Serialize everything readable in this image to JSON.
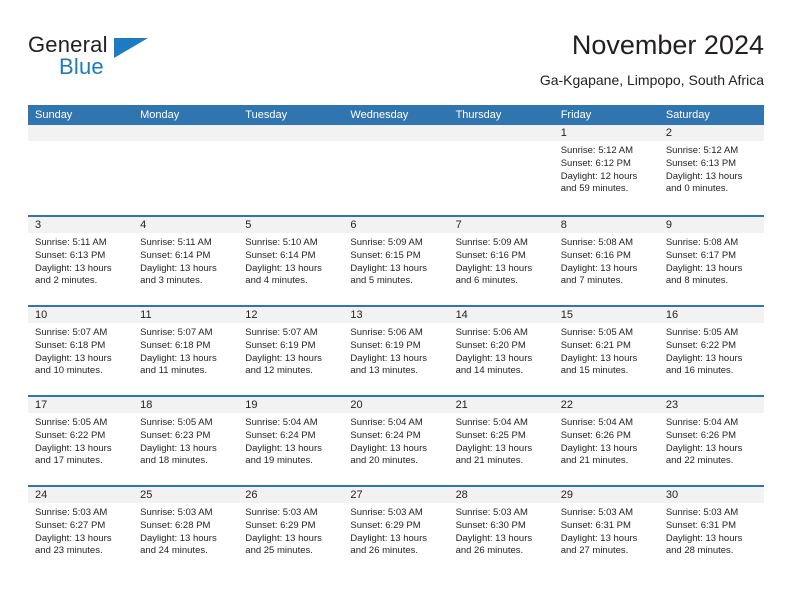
{
  "logo": {
    "word_top": "General",
    "word_bottom": "Blue",
    "triangle_icon": "triangle-icon",
    "accent_color": "#1f7bc1"
  },
  "header": {
    "title": "November 2024",
    "subtitle": "Ga-Kgapane, Limpopo, South Africa"
  },
  "calendar": {
    "header_color": "#3175b0",
    "band_color": "#f2f2f2",
    "weekdays": [
      "Sunday",
      "Monday",
      "Tuesday",
      "Wednesday",
      "Thursday",
      "Friday",
      "Saturday"
    ],
    "weeks": [
      [
        {
          "day": "",
          "sunrise": "",
          "sunset": "",
          "daylight": "",
          "empty": true
        },
        {
          "day": "",
          "sunrise": "",
          "sunset": "",
          "daylight": "",
          "empty": true
        },
        {
          "day": "",
          "sunrise": "",
          "sunset": "",
          "daylight": "",
          "empty": true
        },
        {
          "day": "",
          "sunrise": "",
          "sunset": "",
          "daylight": "",
          "empty": true
        },
        {
          "day": "",
          "sunrise": "",
          "sunset": "",
          "daylight": "",
          "empty": true
        },
        {
          "day": "1",
          "sunrise": "Sunrise: 5:12 AM",
          "sunset": "Sunset: 6:12 PM",
          "daylight": "Daylight: 12 hours and 59 minutes.",
          "empty": false
        },
        {
          "day": "2",
          "sunrise": "Sunrise: 5:12 AM",
          "sunset": "Sunset: 6:13 PM",
          "daylight": "Daylight: 13 hours and 0 minutes.",
          "empty": false
        }
      ],
      [
        {
          "day": "3",
          "sunrise": "Sunrise: 5:11 AM",
          "sunset": "Sunset: 6:13 PM",
          "daylight": "Daylight: 13 hours and 2 minutes.",
          "empty": false
        },
        {
          "day": "4",
          "sunrise": "Sunrise: 5:11 AM",
          "sunset": "Sunset: 6:14 PM",
          "daylight": "Daylight: 13 hours and 3 minutes.",
          "empty": false
        },
        {
          "day": "5",
          "sunrise": "Sunrise: 5:10 AM",
          "sunset": "Sunset: 6:14 PM",
          "daylight": "Daylight: 13 hours and 4 minutes.",
          "empty": false
        },
        {
          "day": "6",
          "sunrise": "Sunrise: 5:09 AM",
          "sunset": "Sunset: 6:15 PM",
          "daylight": "Daylight: 13 hours and 5 minutes.",
          "empty": false
        },
        {
          "day": "7",
          "sunrise": "Sunrise: 5:09 AM",
          "sunset": "Sunset: 6:16 PM",
          "daylight": "Daylight: 13 hours and 6 minutes.",
          "empty": false
        },
        {
          "day": "8",
          "sunrise": "Sunrise: 5:08 AM",
          "sunset": "Sunset: 6:16 PM",
          "daylight": "Daylight: 13 hours and 7 minutes.",
          "empty": false
        },
        {
          "day": "9",
          "sunrise": "Sunrise: 5:08 AM",
          "sunset": "Sunset: 6:17 PM",
          "daylight": "Daylight: 13 hours and 8 minutes.",
          "empty": false
        }
      ],
      [
        {
          "day": "10",
          "sunrise": "Sunrise: 5:07 AM",
          "sunset": "Sunset: 6:18 PM",
          "daylight": "Daylight: 13 hours and 10 minutes.",
          "empty": false
        },
        {
          "day": "11",
          "sunrise": "Sunrise: 5:07 AM",
          "sunset": "Sunset: 6:18 PM",
          "daylight": "Daylight: 13 hours and 11 minutes.",
          "empty": false
        },
        {
          "day": "12",
          "sunrise": "Sunrise: 5:07 AM",
          "sunset": "Sunset: 6:19 PM",
          "daylight": "Daylight: 13 hours and 12 minutes.",
          "empty": false
        },
        {
          "day": "13",
          "sunrise": "Sunrise: 5:06 AM",
          "sunset": "Sunset: 6:19 PM",
          "daylight": "Daylight: 13 hours and 13 minutes.",
          "empty": false
        },
        {
          "day": "14",
          "sunrise": "Sunrise: 5:06 AM",
          "sunset": "Sunset: 6:20 PM",
          "daylight": "Daylight: 13 hours and 14 minutes.",
          "empty": false
        },
        {
          "day": "15",
          "sunrise": "Sunrise: 5:05 AM",
          "sunset": "Sunset: 6:21 PM",
          "daylight": "Daylight: 13 hours and 15 minutes.",
          "empty": false
        },
        {
          "day": "16",
          "sunrise": "Sunrise: 5:05 AM",
          "sunset": "Sunset: 6:22 PM",
          "daylight": "Daylight: 13 hours and 16 minutes.",
          "empty": false
        }
      ],
      [
        {
          "day": "17",
          "sunrise": "Sunrise: 5:05 AM",
          "sunset": "Sunset: 6:22 PM",
          "daylight": "Daylight: 13 hours and 17 minutes.",
          "empty": false
        },
        {
          "day": "18",
          "sunrise": "Sunrise: 5:05 AM",
          "sunset": "Sunset: 6:23 PM",
          "daylight": "Daylight: 13 hours and 18 minutes.",
          "empty": false
        },
        {
          "day": "19",
          "sunrise": "Sunrise: 5:04 AM",
          "sunset": "Sunset: 6:24 PM",
          "daylight": "Daylight: 13 hours and 19 minutes.",
          "empty": false
        },
        {
          "day": "20",
          "sunrise": "Sunrise: 5:04 AM",
          "sunset": "Sunset: 6:24 PM",
          "daylight": "Daylight: 13 hours and 20 minutes.",
          "empty": false
        },
        {
          "day": "21",
          "sunrise": "Sunrise: 5:04 AM",
          "sunset": "Sunset: 6:25 PM",
          "daylight": "Daylight: 13 hours and 21 minutes.",
          "empty": false
        },
        {
          "day": "22",
          "sunrise": "Sunrise: 5:04 AM",
          "sunset": "Sunset: 6:26 PM",
          "daylight": "Daylight: 13 hours and 21 minutes.",
          "empty": false
        },
        {
          "day": "23",
          "sunrise": "Sunrise: 5:04 AM",
          "sunset": "Sunset: 6:26 PM",
          "daylight": "Daylight: 13 hours and 22 minutes.",
          "empty": false
        }
      ],
      [
        {
          "day": "24",
          "sunrise": "Sunrise: 5:03 AM",
          "sunset": "Sunset: 6:27 PM",
          "daylight": "Daylight: 13 hours and 23 minutes.",
          "empty": false
        },
        {
          "day": "25",
          "sunrise": "Sunrise: 5:03 AM",
          "sunset": "Sunset: 6:28 PM",
          "daylight": "Daylight: 13 hours and 24 minutes.",
          "empty": false
        },
        {
          "day": "26",
          "sunrise": "Sunrise: 5:03 AM",
          "sunset": "Sunset: 6:29 PM",
          "daylight": "Daylight: 13 hours and 25 minutes.",
          "empty": false
        },
        {
          "day": "27",
          "sunrise": "Sunrise: 5:03 AM",
          "sunset": "Sunset: 6:29 PM",
          "daylight": "Daylight: 13 hours and 26 minutes.",
          "empty": false
        },
        {
          "day": "28",
          "sunrise": "Sunrise: 5:03 AM",
          "sunset": "Sunset: 6:30 PM",
          "daylight": "Daylight: 13 hours and 26 minutes.",
          "empty": false
        },
        {
          "day": "29",
          "sunrise": "Sunrise: 5:03 AM",
          "sunset": "Sunset: 6:31 PM",
          "daylight": "Daylight: 13 hours and 27 minutes.",
          "empty": false
        },
        {
          "day": "30",
          "sunrise": "Sunrise: 5:03 AM",
          "sunset": "Sunset: 6:31 PM",
          "daylight": "Daylight: 13 hours and 28 minutes.",
          "empty": false
        }
      ]
    ]
  }
}
